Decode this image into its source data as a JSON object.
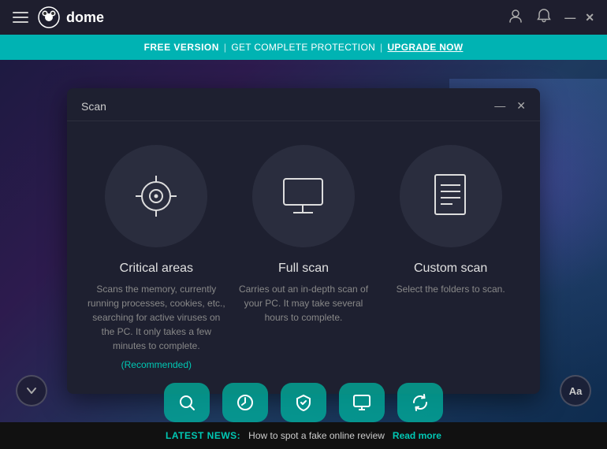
{
  "topbar": {
    "logo_text": "dome",
    "account_icon": "👤",
    "bell_icon": "🔔",
    "minimize_label": "—",
    "close_label": "✕"
  },
  "banner": {
    "free_version": "FREE VERSION",
    "divider1": "|",
    "protection_text": "GET COMPLETE PROTECTION",
    "divider2": "|",
    "upgrade_text": "UPGRADE NOW"
  },
  "modal": {
    "title": "Scan",
    "minimize": "—",
    "close": "✕",
    "options": [
      {
        "id": "critical",
        "title": "Critical areas",
        "description": "Scans the memory, currently running processes, cookies, etc., searching for active viruses on the PC. It only takes a few minutes to complete.",
        "recommended": "(Recommended)"
      },
      {
        "id": "full",
        "title": "Full scan",
        "description": "Carries out an in-depth scan of your PC. It may take several hours to complete.",
        "recommended": ""
      },
      {
        "id": "custom",
        "title": "Custom scan",
        "description": "Select the folders to scan.",
        "recommended": ""
      }
    ]
  },
  "bottom_icons": [
    {
      "id": "search",
      "label": "Search"
    },
    {
      "id": "history",
      "label": "History"
    },
    {
      "id": "shield",
      "label": "Shield"
    },
    {
      "id": "monitor",
      "label": "Monitor"
    },
    {
      "id": "refresh",
      "label": "Refresh"
    }
  ],
  "news": {
    "label": "LATEST NEWS:",
    "text": "How to spot a fake online review",
    "read_more": "Read more"
  },
  "scroll_btn": "❯",
  "font_btn": "Aa"
}
